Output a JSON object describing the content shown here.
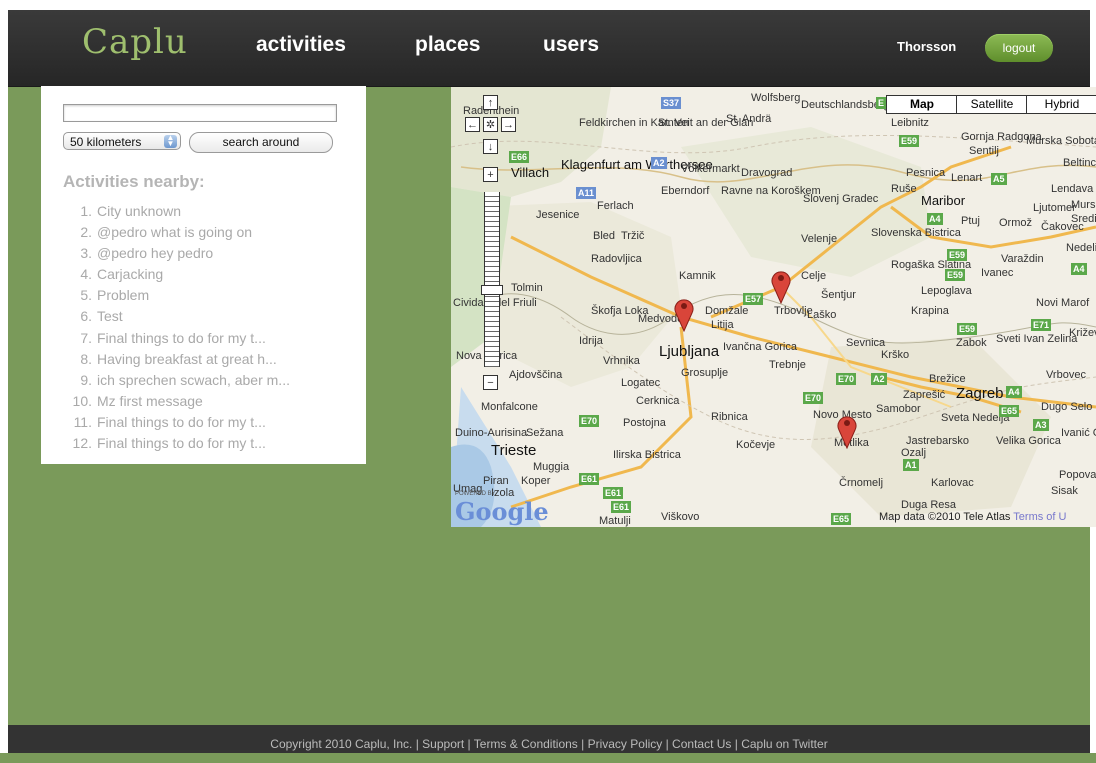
{
  "header": {
    "logo": "Caplu",
    "nav": [
      "activities",
      "places",
      "users"
    ],
    "username": "Thorsson",
    "logout_label": "logout"
  },
  "sidebar": {
    "search_value": "",
    "radius_value": "50 kilometers",
    "search_button": "search around",
    "nearby_title": "Activities nearby:",
    "activities": [
      "City unknown",
      "@pedro what is going on",
      "@pedro hey pedro",
      "Carjacking",
      "Problem",
      "Test",
      "Final things to do for my t...",
      "Having breakfast at great h...",
      "ich sprechen scwach, aber m...",
      "Mz first message",
      "Final things to do for my t...",
      "Final things to do for my t..."
    ]
  },
  "map": {
    "types": [
      "Map",
      "Satellite",
      "Hybrid"
    ],
    "selected_type": "Map",
    "credits": "Map data ©2010 Tele Atlas",
    "terms_label": "Terms of U",
    "powered_by": "POWERED BY",
    "logo_text": "Google",
    "labels": {
      "l01": "Radenthein",
      "l02": "Feldkirchen in Kärnten",
      "l03": "St. Veit an der Glan",
      "l04": "St. Andrä",
      "l05": "Wolfsberg",
      "l06": "Deutschlandsberg",
      "l07": "Leibnitz",
      "l08": "Villach",
      "l09": "Klagenfurt am Wörthersee",
      "l10": "Völkermarkt",
      "l11": "Dravograd",
      "l12": "Pesnica",
      "l13": "Lenart",
      "l14": "Ruše",
      "l15": "Maribor",
      "l16": "Ptuj",
      "l17": "Ormož",
      "l18": "Čakovec",
      "l19": "Ljutomer",
      "l20": "Lendava",
      "l21": "Murska Sobota",
      "l22": "Gornja Radgona",
      "l23": "Jesenice",
      "l24": "Ferlach",
      "l25": "Eberndorf",
      "l26": "Ravne na Koroškem",
      "l27": "Slovenj Gradec",
      "l28": "Velenje",
      "l29": "Slovenska Bistrica",
      "l30": "Bled",
      "l31": "Tržič",
      "l32": "Radovljica",
      "l33": "Kamnik",
      "l34": "Celje",
      "l35": "Šentjur",
      "l36": "Rogaška Slatina",
      "l37": "Varaždin",
      "l38": "Ivanec",
      "l39": "Lepoglava",
      "l40": "Tolmin",
      "l41": "Cividale del Friuli",
      "l42": "Škofja Loka",
      "l43": "Medvode",
      "l44": "Domžale",
      "l45": "Trbovlje",
      "l46": "Laško",
      "l47": "Litija",
      "l48": "Krapina",
      "l49": "Zabok",
      "l50": "Sveti Ivan Zelina",
      "l51": "Novi Marof",
      "l52": "Križevci",
      "l53": "Nova Gorica",
      "l54": "Idrija",
      "l55": "Vrhnika",
      "l56": "Ljubljana",
      "l57": "Ivančna Gorica",
      "l58": "Sevnica",
      "l59": "Krško",
      "l60": "Brežice",
      "l61": "Zaprešić",
      "l62": "Zagreb",
      "l63": "Ajdovščina",
      "l64": "Logatec",
      "l65": "Grosuplje",
      "l66": "Trebnje",
      "l67": "Samobor",
      "l68": "Dugo Selo",
      "l69": "Vrbovec",
      "l70": "Monfalcone",
      "l71": "Cerknica",
      "l72": "Novo Mesto",
      "l73": "Sveta Nedelja",
      "l74": "Postojna",
      "l75": "Ribnica",
      "l76": "Duino-Aurisina",
      "l77": "Sežana",
      "l78": "Kočevje",
      "l79": "Metlika",
      "l80": "Jastrebarsko",
      "l81": "Velika Gorica",
      "l82": "Ozalj",
      "l83": "Ivanić Grad",
      "l84": "Trieste",
      "l85": "Muggia",
      "l86": "Ilirska Bistrica",
      "l87": "Piran",
      "l88": "Koper",
      "l89": "Izola",
      "l90": "Umag",
      "l91": "Črnomelj",
      "l92": "Karlovac",
      "l93": "Sisak",
      "l94": "Popovača",
      "l95": "Duga Resa",
      "l96": "Matulji",
      "l97": "Viškovo",
      "l98": "Sentilj",
      "l99": "Beltinci",
      "l100": "Središče",
      "l101": "Nedelišće",
      "l102": "Mursko"
    },
    "shields": {
      "s1": "S37",
      "s2": "E66",
      "s3": "A2",
      "s4": "A11",
      "s5": "E59",
      "s6": "A5",
      "s7": "A4",
      "s8": "E59",
      "s9": "E59",
      "s10": "A4",
      "s11": "E57",
      "s12": "E59",
      "s13": "E71",
      "s14": "E70",
      "s15": "A2",
      "s16": "E70",
      "s17": "A4",
      "s18": "E65",
      "s19": "A3",
      "s20": "E70",
      "s21": "E61",
      "s22": "E61",
      "s23": "A1",
      "s24": "E61",
      "s25": "E65",
      "s26": "E"
    },
    "markers": 3
  },
  "footer": {
    "text": "Copyright 2010 Caplu, Inc. | Support | Terms & Conditions | Privacy Policy | Contact Us | Caplu on Twitter"
  },
  "colors": {
    "page_bg": "#7a9a5a",
    "header_bg": "#2f2f2f",
    "logo": "#9fbf6e",
    "logout_button": "#6f9f3a",
    "muted_text": "#a9a9a9",
    "marker": "#d9453a"
  }
}
